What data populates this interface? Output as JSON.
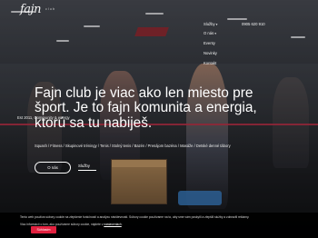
{
  "header": {
    "logo": "fajn",
    "logo_sub": "club",
    "phone": "0905 620 910"
  },
  "menu": {
    "items": [
      {
        "label": "Služby",
        "has_dropdown": true
      },
      {
        "label": "O nás",
        "has_dropdown": true
      },
      {
        "label": "Eventy",
        "has_dropdown": false
      },
      {
        "label": "Novinky",
        "has_dropdown": false
      },
      {
        "label": "Kontakt",
        "has_dropdown": false
      }
    ]
  },
  "hero": {
    "headline": "Fajn club je viac ako len miesto pre šport. Je to fajn komunita a energia, ktorú sa tu nabiješ.",
    "side_note": "Est 2011, Community & energy",
    "tags": "Squash / Fitness / Skupinové tréningy / Tenis / Stolný tenis / Bazén / Prenájom bazéna / Masáže / Detské denné tábory",
    "about_button": "O nás",
    "services_link": "Služby"
  },
  "cookie": {
    "text1": "Tento web používa súbory cookie na zlepšenie funkčnosti a analýzu návštevnosti. Súbory cookie používame na to, aby sme vám poskytli a zlepšili služby a zobrazili reklamy.",
    "text2_prefix": "Viac informácií o tom, ako používame súbory cookie, nájdete v",
    "text2_link": "nastaveniach",
    "accept_button": "Súhlasím"
  }
}
